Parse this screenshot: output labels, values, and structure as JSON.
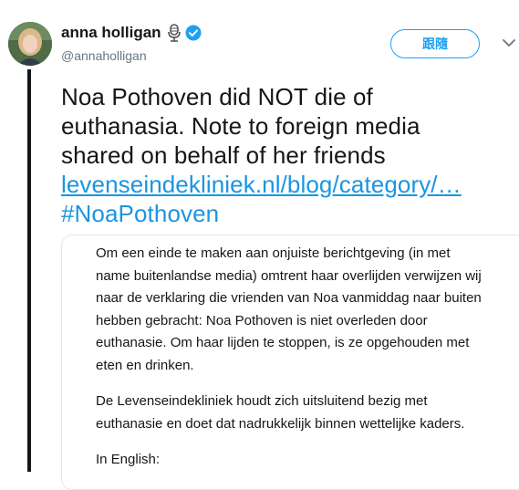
{
  "user": {
    "display_name": "anna holligan",
    "handle": "@annaholligan",
    "avatar_icon": "user-photo",
    "badges": [
      "microphone-icon",
      "verified-icon"
    ]
  },
  "follow_label": "跟隨",
  "tweet": {
    "lines": [
      "Noa Pothoven did NOT die of",
      "euthanasia. Note to foreign media",
      "shared on behalf of her friends"
    ],
    "link": "levenseindekliniek.nl/blog/category/…",
    "hashtag": "#NoaPothoven"
  },
  "quote": {
    "paragraph1": [
      "Om een einde te maken aan onjuiste berichtgeving (in met",
      "name buitenlandse media) omtrent haar overlijden verwijzen wij",
      "naar de verklaring die vrienden van Noa vanmiddag naar buiten",
      "hebben gebracht: Noa Pothoven is niet overleden door",
      "euthanasie. Om haar lijden te stoppen, is ze opgehouden met",
      "eten en drinken."
    ],
    "paragraph2": [
      "De Levenseindekliniek houdt zich uitsluitend bezig met",
      "euthanasie en doet dat nadrukkelijk binnen wettelijke kaders."
    ],
    "paragraph3": [
      "In English:"
    ]
  },
  "colors": {
    "accent": "#1da1f2",
    "link": "#1b95e0",
    "text": "#14171a",
    "muted": "#657786"
  }
}
